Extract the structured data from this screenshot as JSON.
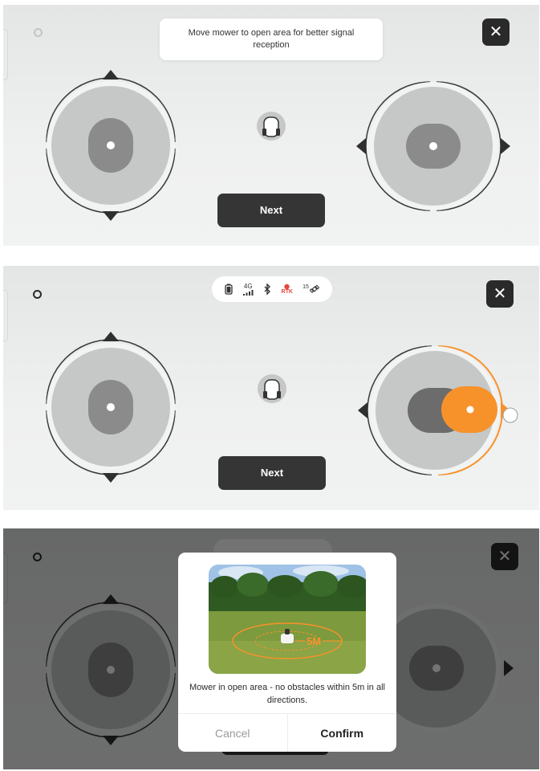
{
  "screens": [
    {
      "toast": "Move mower to open area for better signal reception",
      "next_label": "Next",
      "close_label": "✕"
    },
    {
      "status_icons": {
        "battery": "battery-icon",
        "network": "4G",
        "bluetooth": "bluetooth-icon",
        "rtk": "RTK",
        "satellites": "15"
      },
      "next_label": "Next",
      "close_label": "✕"
    },
    {
      "dialog": {
        "image_label": "5M",
        "message": "Mower in open area - no obstacles within 5m in all directions.",
        "cancel_label": "Cancel",
        "confirm_label": "Confirm"
      },
      "close_label": "✕"
    }
  ],
  "colors": {
    "accent": "#f7922a",
    "button_dark": "#353535"
  }
}
